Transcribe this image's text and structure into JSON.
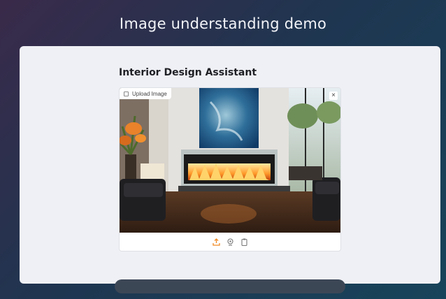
{
  "page": {
    "title": "Image understanding demo"
  },
  "section": {
    "heading": "Interior Design Assistant"
  },
  "upload": {
    "tab_label": "Upload Image",
    "clear_symbol": "×",
    "tools": [
      "upload-icon",
      "webcam-icon",
      "clipboard-icon"
    ]
  },
  "colors": {
    "accent": "#f08a24",
    "card_bg": "#eff0f5",
    "heading": "#1e1f24"
  }
}
